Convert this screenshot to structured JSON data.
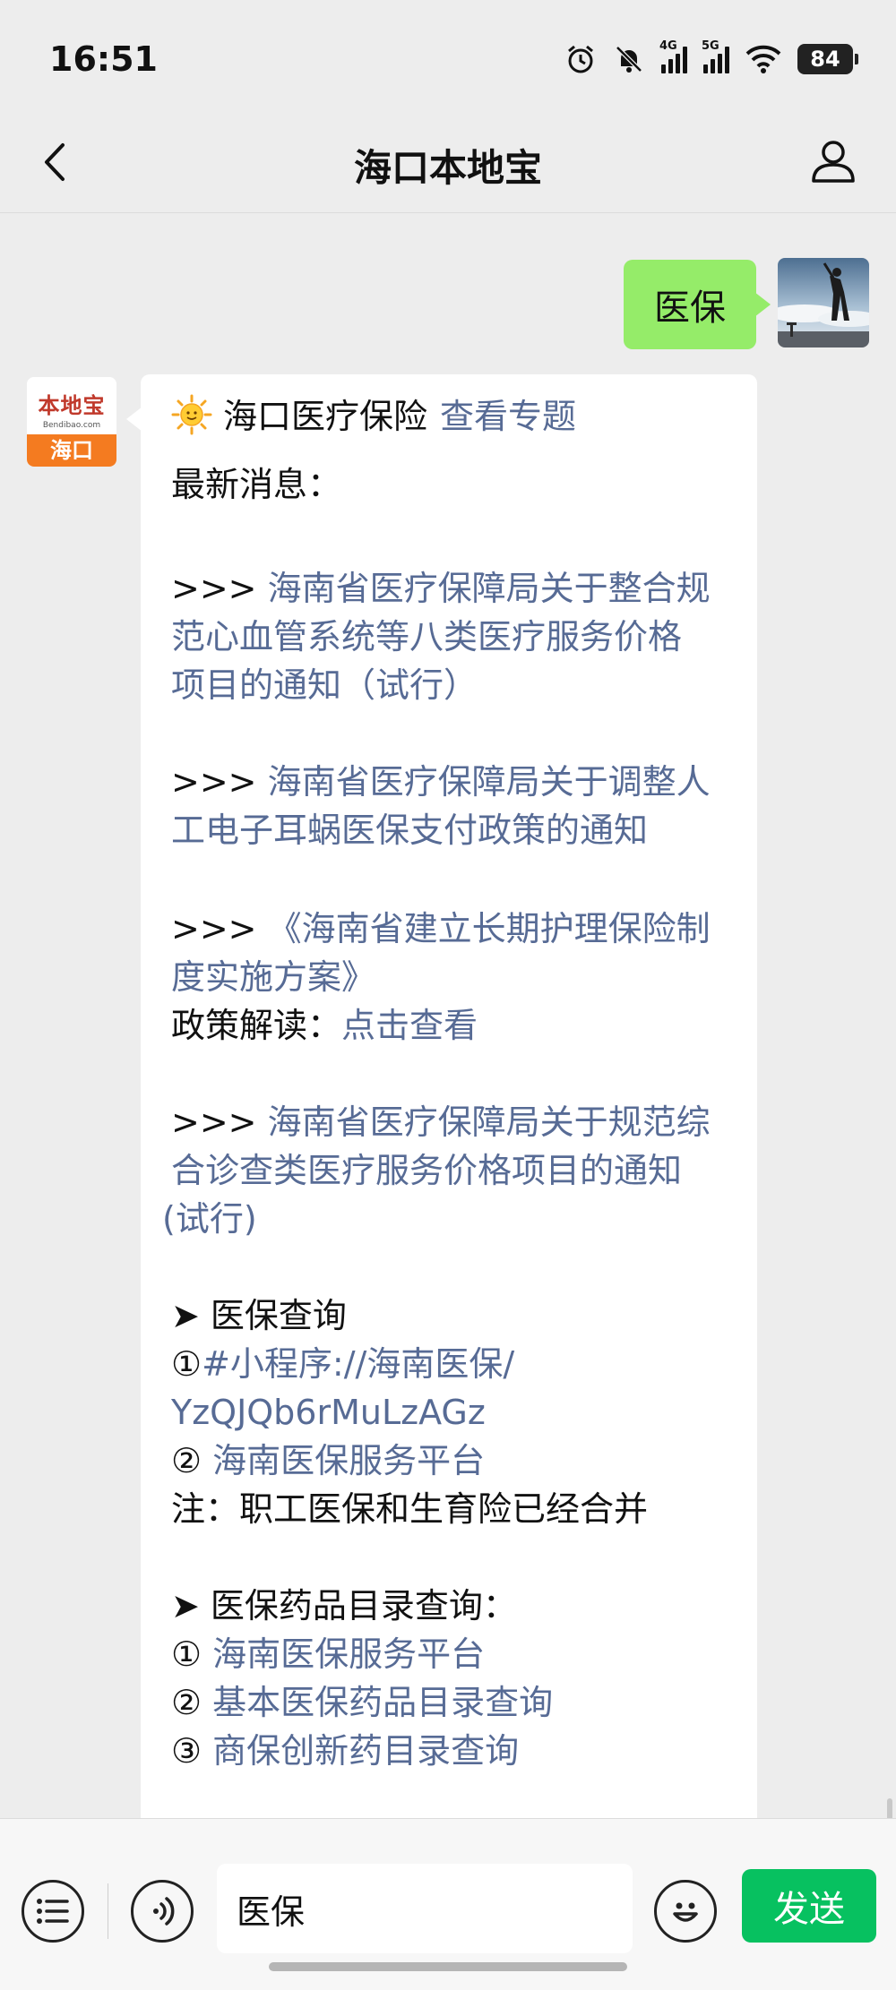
{
  "status": {
    "time": "16:51",
    "battery": "84",
    "net1": "4G",
    "net2": "5G"
  },
  "nav": {
    "title": "海口本地宝"
  },
  "user_message": {
    "text": "医保"
  },
  "bot": {
    "avatar_brand": "本地宝",
    "avatar_domain": "Bendibao.com",
    "avatar_city": "海口",
    "header_title": "海口医疗保险",
    "header_link": "查看专题",
    "latest_label": "最新消息：",
    "arrow_prefix": ">>> ",
    "news1_l1": "海南省医疗保障局关于整合规",
    "news1_l2": "范心血管系统等八类医疗服务价格",
    "news1_l3": "项目的通知（试行）",
    "news2_l1": "海南省医疗保障局关于调整人",
    "news2_l2": "工电子耳蜗医保支付政策的通知",
    "news3_l1": "《海南省建立长期护理保险制",
    "news3_l2": "度实施方案》",
    "policy_label": "政策解读：",
    "policy_link": "点击查看",
    "news4_l1": "海南省医疗保障局关于规范综",
    "news4_l2": "合诊查类医疗服务价格项目的通知",
    "news4_l3": "(试行)",
    "sec1_title": "➤ 医保查询",
    "sec1_item1_num": "①",
    "sec1_item1_l1": "#小程序://海南医保/",
    "sec1_item1_l2": "YzQJQb6rMuLzAGz",
    "sec1_item2_num": "②",
    "sec1_item2": "海南医保服务平台",
    "sec1_note": "注：职工医保和生育险已经合并",
    "sec2_title": "➤ 医保药品目录查询：",
    "sec2_item1_num": "①",
    "sec2_item1": "海南医保服务平台",
    "sec2_item2_num": "②",
    "sec2_item2": "基本医保药品目录查询",
    "sec2_item3_num": "③",
    "sec2_item3": "商保创新药目录查询"
  },
  "input": {
    "value": "医保",
    "send_label": "发送"
  }
}
